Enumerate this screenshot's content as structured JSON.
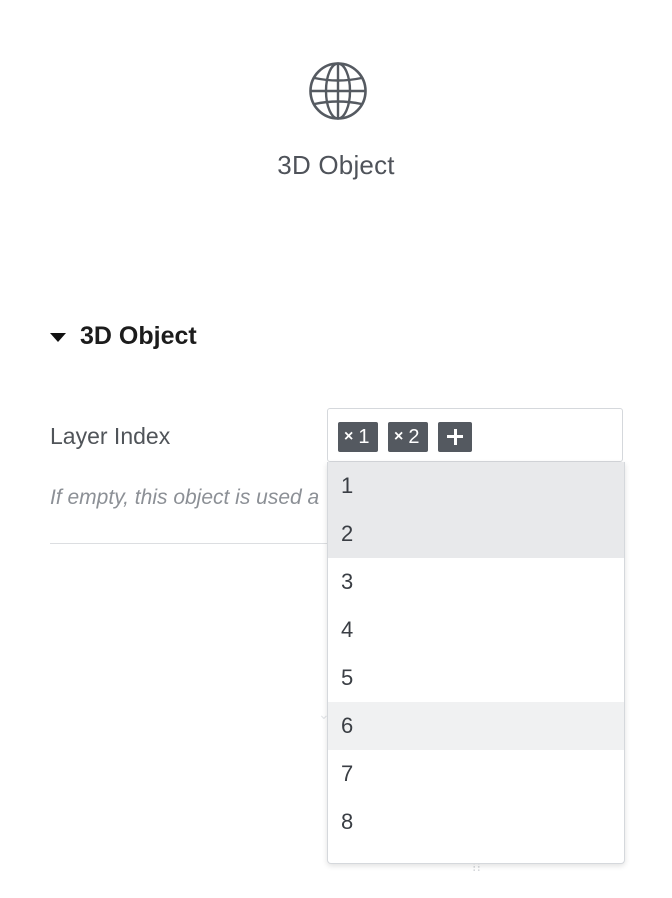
{
  "header": {
    "icon": "globe-icon",
    "title": "3D Object"
  },
  "section": {
    "icon": "caret-down-icon",
    "title": "3D Object"
  },
  "field": {
    "label": "Layer Index",
    "hint": "If empty, this object is used a",
    "selected_chips": [
      {
        "remove_glyph": "×",
        "value": "1"
      },
      {
        "remove_glyph": "×",
        "value": "2"
      }
    ],
    "add_icon": "plus-icon",
    "options": [
      {
        "label": "1",
        "state": "selected"
      },
      {
        "label": "2",
        "state": "selected"
      },
      {
        "label": "3",
        "state": "normal"
      },
      {
        "label": "4",
        "state": "normal"
      },
      {
        "label": "5",
        "state": "normal"
      },
      {
        "label": "6",
        "state": "hover"
      },
      {
        "label": "7",
        "state": "normal"
      },
      {
        "label": "8",
        "state": "normal"
      }
    ]
  },
  "colors": {
    "chip_background": "#545960",
    "selected_option_background": "#e8e9eb",
    "hover_option_background": "#f0f1f2"
  }
}
